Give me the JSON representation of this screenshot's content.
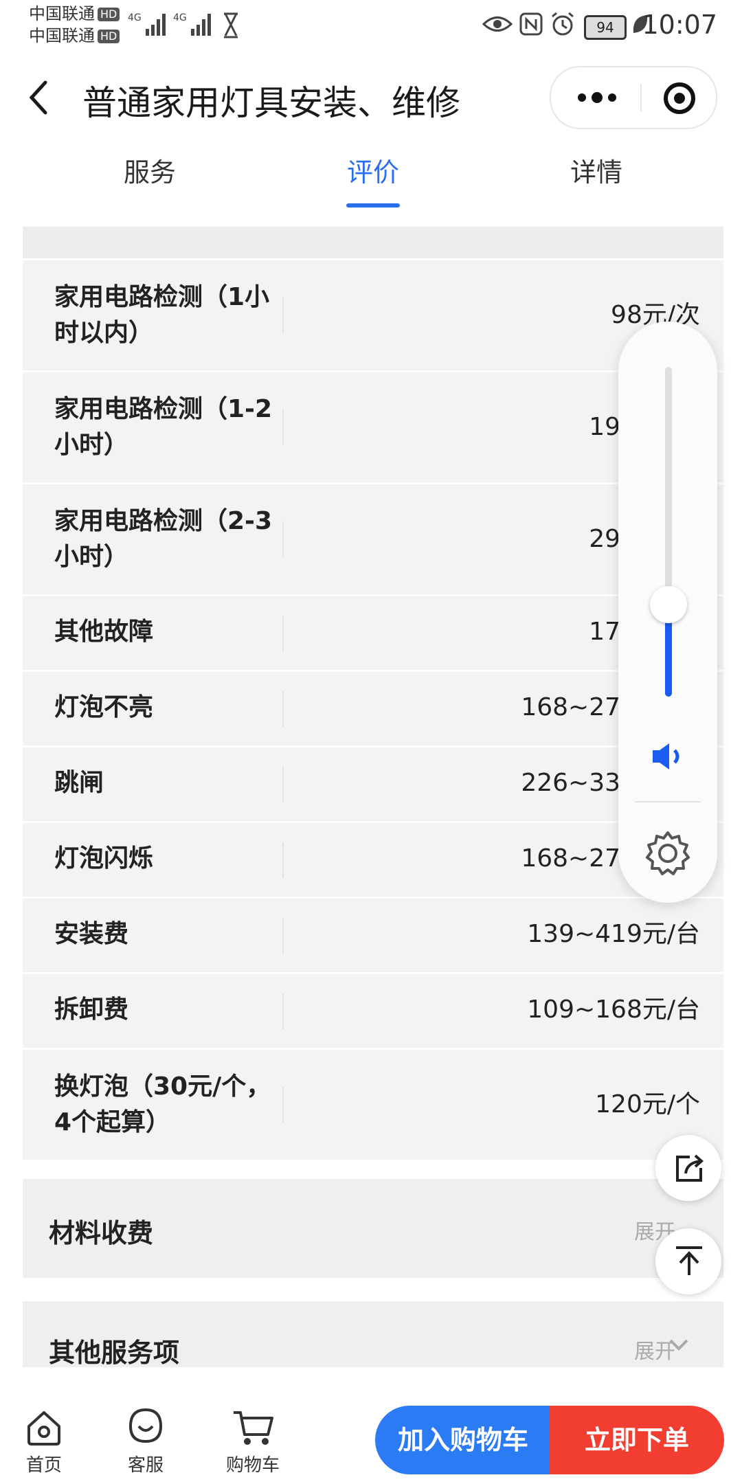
{
  "status_bar": {
    "carrier1": "中国联通",
    "carrier2": "中国联通",
    "hd": "HD",
    "network1": "4G",
    "network2": "4G",
    "battery": "94",
    "time": "10:07"
  },
  "header": {
    "title": "普通家用灯具安装、维修"
  },
  "tabs": [
    {
      "label": "服务"
    },
    {
      "label": "评价"
    },
    {
      "label": "详情"
    }
  ],
  "active_tab": "评价",
  "price_rows": [
    {
      "name": "家用电路检测（1小时以内）",
      "price": "98元/次"
    },
    {
      "name": "家用电路检测（1-2小时）",
      "price": "19"
    },
    {
      "name": "家用电路检测（2-3小时）",
      "price": "29"
    },
    {
      "name": "其他故障",
      "price": "17"
    },
    {
      "name": "灯泡不亮",
      "price": "168~27"
    },
    {
      "name": "跳闸",
      "price": "226~33"
    },
    {
      "name": "灯泡闪烁",
      "price": "168~27"
    },
    {
      "name": "安装费",
      "price": "139~419元/台"
    },
    {
      "name": "拆卸费",
      "price": "109~168元/台"
    },
    {
      "name": "换灯泡（30元/个，4个起算）",
      "price": "120元/个"
    }
  ],
  "sections": [
    {
      "title": "材料收费",
      "expand": "展开"
    },
    {
      "title": "其他服务项",
      "expand": "展开"
    }
  ],
  "volume": {
    "level": 0.28
  },
  "bottom_nav": [
    {
      "label": "首页"
    },
    {
      "label": "客服"
    },
    {
      "label": "购物车"
    }
  ],
  "actions": {
    "add_to_cart": "加入购物车",
    "order_now": "立即下单"
  },
  "colors": {
    "accent": "#2a6ff0",
    "cart_button": "#2b7bf5",
    "order_button": "#f23d31",
    "volume_fill": "#1a5cf0"
  }
}
